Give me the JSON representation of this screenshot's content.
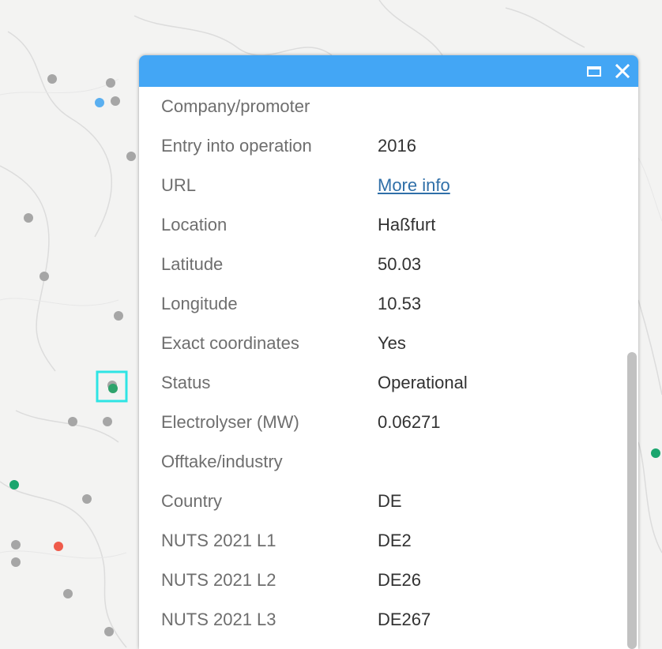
{
  "map": {
    "points": [
      {
        "status": "other",
        "color": "#a6a6a6"
      },
      {
        "status": "other",
        "color": "#a6a6a6"
      },
      {
        "status": "other",
        "color": "#a6a6a6"
      },
      {
        "status": "planned",
        "color": "#5aaff0"
      },
      {
        "status": "other",
        "color": "#a6a6a6"
      },
      {
        "status": "other",
        "color": "#a6a6a6"
      },
      {
        "status": "other",
        "color": "#a6a6a6"
      },
      {
        "status": "other",
        "color": "#a6a6a6"
      },
      {
        "status": "other",
        "color": "#a6a6a6"
      },
      {
        "status": "operational-selected",
        "color": "#2ea36c"
      },
      {
        "status": "other",
        "color": "#a6a6a6"
      },
      {
        "status": "other",
        "color": "#a6a6a6"
      },
      {
        "status": "operational",
        "color": "#1aa56e"
      },
      {
        "status": "other",
        "color": "#a6a6a6"
      },
      {
        "status": "other",
        "color": "#a6a6a6"
      },
      {
        "status": "decommissioned",
        "color": "#ef5b4b"
      },
      {
        "status": "other",
        "color": "#a6a6a6"
      },
      {
        "status": "other",
        "color": "#a6a6a6"
      },
      {
        "status": "other",
        "color": "#a6a6a6"
      },
      {
        "status": "operational",
        "color": "#1aa56e"
      }
    ],
    "selection_color": "#2ee4e4"
  },
  "popup": {
    "header_color": "#43a6f5",
    "maximize_icon": "maximize-icon",
    "close_icon": "close-icon",
    "close_glyph": "✕",
    "attributes": [
      {
        "label": "Company/promoter",
        "value": ""
      },
      {
        "label": "Entry into operation",
        "value": "2016"
      },
      {
        "label": "URL",
        "value": "More info",
        "link": true
      },
      {
        "label": "Location",
        "value": "Haßfurt"
      },
      {
        "label": "Latitude",
        "value": "50.03"
      },
      {
        "label": "Longitude",
        "value": "10.53"
      },
      {
        "label": "Exact coordinates",
        "value": "Yes"
      },
      {
        "label": "Status",
        "value": "Operational"
      },
      {
        "label": "Electrolyser (MW)",
        "value": "0.06271"
      },
      {
        "label": "Offtake/industry",
        "value": ""
      },
      {
        "label": "Country",
        "value": "DE"
      },
      {
        "label": "NUTS 2021 L1",
        "value": "DE2"
      },
      {
        "label": "NUTS 2021 L2",
        "value": "DE26"
      },
      {
        "label": "NUTS 2021 L3",
        "value": "DE267"
      }
    ]
  }
}
